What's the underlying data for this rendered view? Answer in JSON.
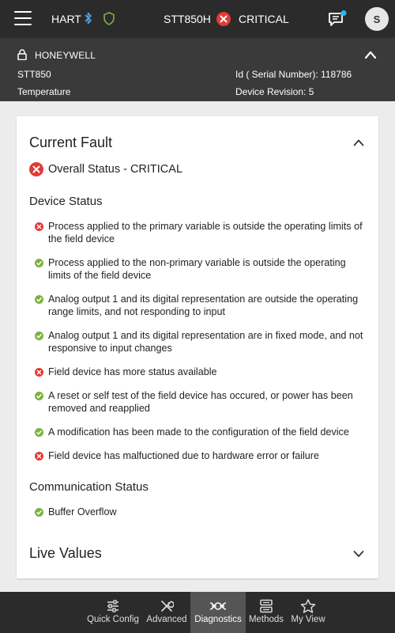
{
  "topbar": {
    "protocol": "HART",
    "device_tag": "STT850H",
    "status": "CRITICAL",
    "avatar_initial": "S"
  },
  "device_header": {
    "manufacturer": "HONEYWELL",
    "model": "STT850",
    "type": "Temperature",
    "serial": "Id ( Serial Number): 118786",
    "revision": "Device Revision: 5"
  },
  "current_fault": {
    "title": "Current Fault",
    "overall": "Overall Status - CRITICAL",
    "device_status_title": "Device Status",
    "device_status_items": [
      {
        "status": "error",
        "text": "Process applied to the primary variable is outside the operating limits of the field device"
      },
      {
        "status": "ok",
        "text": "Process applied to the non-primary variable is outside the operating limits of the field device"
      },
      {
        "status": "ok",
        "text": "Analog output 1 and its digital representation are outside the operating range limits, and not responding to input"
      },
      {
        "status": "ok",
        "text": "Analog output 1 and its digital representation are in fixed mode, and not responsive to input changes"
      },
      {
        "status": "error",
        "text": "Field device has more status available"
      },
      {
        "status": "ok",
        "text": "A reset or self test of the field device has occured, or power has been removed and reapplied"
      },
      {
        "status": "ok",
        "text": "A modification has been made to the configuration of the field device"
      },
      {
        "status": "error",
        "text": "Field device has malfuctioned due to hardware error or failure"
      }
    ],
    "comm_status_title": "Communication Status",
    "comm_status_items": [
      {
        "status": "ok",
        "text": "Buffer Overflow"
      }
    ]
  },
  "live_values": {
    "title": "Live Values"
  },
  "bottom_nav": [
    {
      "label": "Quick Config",
      "icon": "sliders-icon"
    },
    {
      "label": "Advanced",
      "icon": "tools-icon"
    },
    {
      "label": "Diagnostics",
      "icon": "dna-icon",
      "active": true
    },
    {
      "label": "Methods",
      "icon": "methods-icon"
    },
    {
      "label": "My View",
      "icon": "star-icon"
    }
  ],
  "colors": {
    "error": "#e53935",
    "ok": "#7cb342",
    "bluetooth": "#4aa3df",
    "shield": "#7cb342",
    "notification_dot": "#29b6f6"
  }
}
